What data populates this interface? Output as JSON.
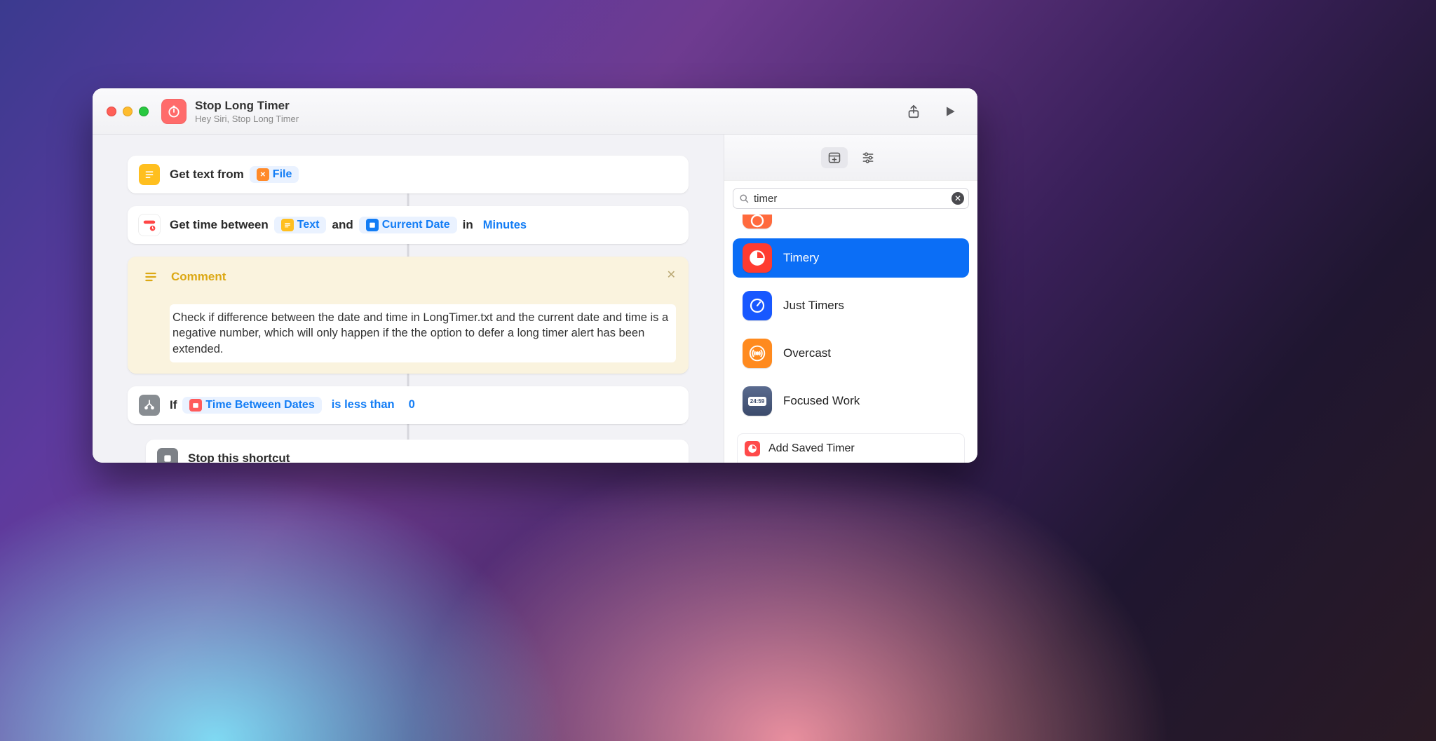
{
  "header": {
    "title": "Stop Long Timer",
    "subtitle": "Hey Siri, Stop Long Timer"
  },
  "actions": {
    "get_text": {
      "label": "Get text from",
      "token_file": "File"
    },
    "get_time": {
      "label": "Get time between",
      "token_text": "Text",
      "and": "and",
      "token_current_date": "Current Date",
      "in": "in",
      "unit": "Minutes"
    },
    "comment": {
      "title": "Comment",
      "body": "Check if difference between the date and time in LongTimer.txt and the current date and time is a negative number, which will only happen if the the option to defer a long timer alert has been extended."
    },
    "if": {
      "label": "If",
      "token_var": "Time Between Dates",
      "condition": "is less than",
      "value": "0"
    },
    "stop": {
      "label": "Stop this shortcut"
    }
  },
  "sidebar": {
    "search_value": "timer",
    "apps": {
      "streaks_partial": "",
      "timery": "Timery",
      "just_timers": "Just Timers",
      "overcast": "Overcast",
      "focused_work": "Focused Work"
    },
    "suggestion": "Add Saved Timer"
  }
}
